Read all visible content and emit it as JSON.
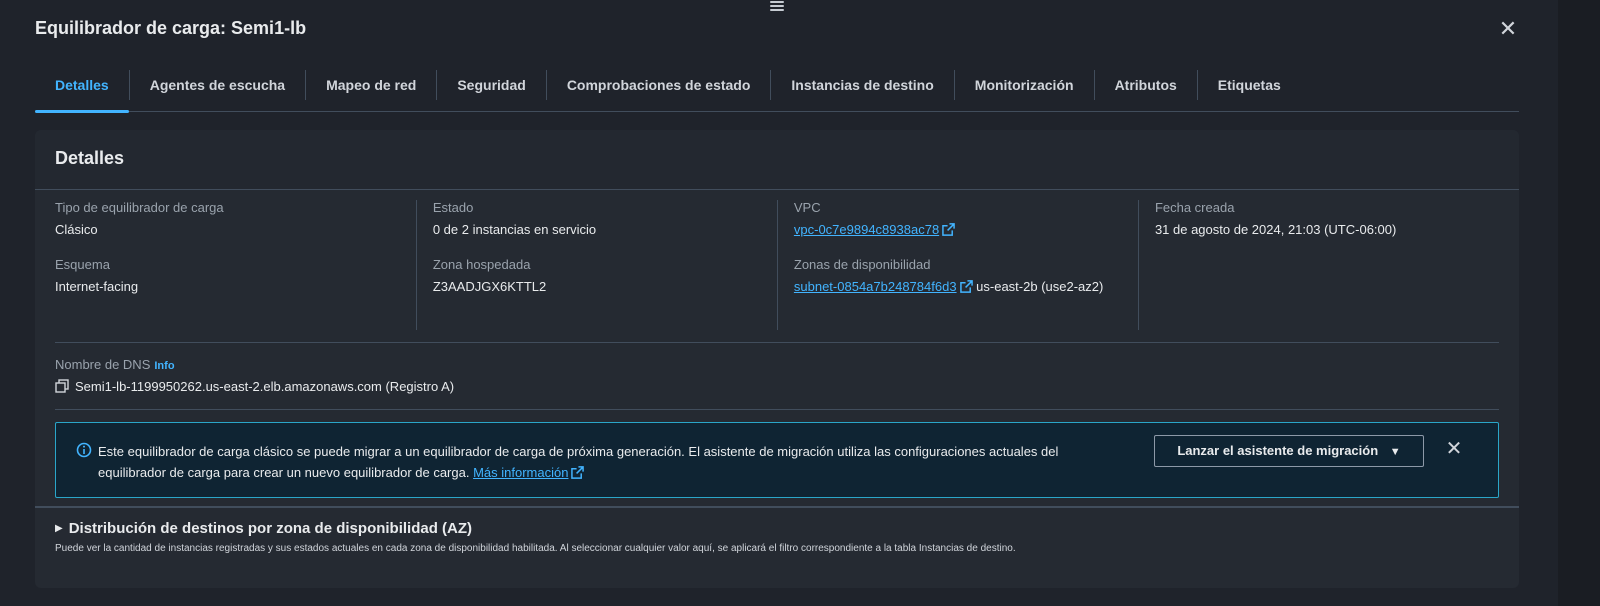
{
  "panel": {
    "title": "Equilibrador de carga: Semi1-lb",
    "close_icon": "close-icon"
  },
  "tabs": [
    {
      "label": "Detalles",
      "active": true
    },
    {
      "label": "Agentes de escucha"
    },
    {
      "label": "Mapeo de red"
    },
    {
      "label": "Seguridad"
    },
    {
      "label": "Comprobaciones de estado"
    },
    {
      "label": "Instancias de destino"
    },
    {
      "label": "Monitorización"
    },
    {
      "label": "Atributos"
    },
    {
      "label": "Etiquetas"
    }
  ],
  "details": {
    "header": "Detalles",
    "type_label": "Tipo de equilibrador de carga",
    "type_value": "Clásico",
    "scheme_label": "Esquema",
    "scheme_value": "Internet-facing",
    "state_label": "Estado",
    "state_value": "0 de 2 instancias en servicio",
    "zone_label": "Zona hospedada",
    "zone_value": "Z3AADJGX6KTTL2",
    "vpc_label": "VPC",
    "vpc_value": "vpc-0c7e9894c8938ac78",
    "az_label": "Zonas de disponibilidad",
    "az_subnet": "subnet-0854a7b248784f6d3",
    "az_suffix": " us-east-2b (use2-az2)",
    "created_label": "Fecha creada",
    "created_value": "31 de agosto de 2024, 21:03 (UTC-06:00)",
    "dns_label": "Nombre de DNS",
    "dns_info": "Info",
    "dns_value": "Semi1-lb-1199950262.us-east-2.elb.amazonaws.com (Registro A)"
  },
  "alert": {
    "text": "Este equilibrador de carga clásico se puede migrar a un equilibrador de carga de próxima generación. El asistente de migración utiliza las configuraciones actuales del equilibrador de carga para crear un nuevo equilibrador de carga. ",
    "link": "Más información",
    "button": "Lanzar el asistente de migración",
    "button_caret": "▼"
  },
  "expander": {
    "title": "Distribución de destinos por zona de disponibilidad (AZ)",
    "caret": "▶",
    "description": "Puede ver la cantidad de instancias registradas y sus estados actuales en cada zona de disponibilidad habilitada. Al seleccionar cualquier valor aquí, se aplicará el filtro correspondiente a la tabla Instancias de destino."
  },
  "colors": {
    "accent": "#42b4ff",
    "alert_border": "#2aa6c9",
    "background": "#1f232b",
    "card": "#252a32"
  }
}
